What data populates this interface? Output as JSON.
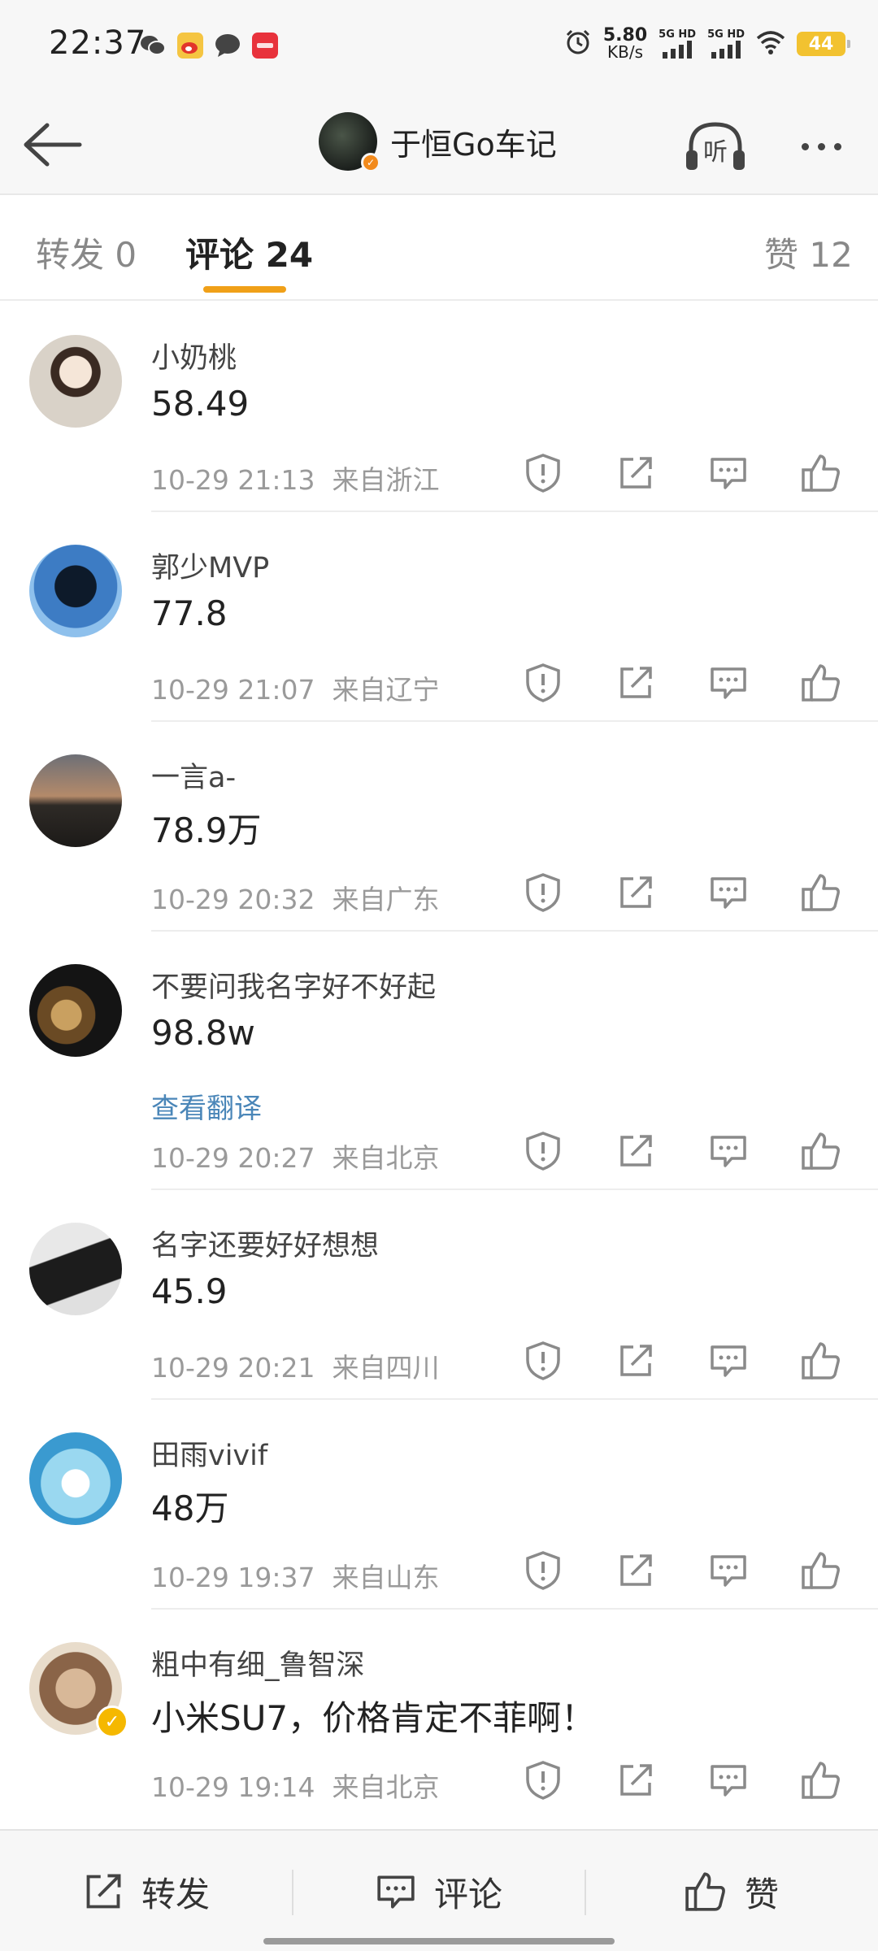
{
  "status_bar": {
    "time": "22:37",
    "left_icons": [
      "wechat-icon",
      "weibo-icon",
      "message-icon",
      "xiaohongshu-icon"
    ],
    "net_speed_value": "5.80",
    "net_speed_unit": "KB/s",
    "signal1_label": "5G HD",
    "signal2_label": "5G HD",
    "battery": "44",
    "battery_color": "#f2c230"
  },
  "header": {
    "title": "于恒Go车记",
    "verified_color": "#f28a1c",
    "listen_label": "听"
  },
  "tabs": [
    {
      "label": "转发 0",
      "active": false
    },
    {
      "label": "评论 24",
      "active": true
    },
    {
      "label": "赞 12",
      "active": false
    }
  ],
  "accent_color": "#f0a018",
  "comments": [
    {
      "name": "小奶桃",
      "text": "58.49",
      "time": "10-29 21:13",
      "location": "来自浙江"
    },
    {
      "name": "郭少MVP",
      "text": "77.8",
      "time": "10-29 21:07",
      "location": "来自辽宁"
    },
    {
      "name": "一言a-",
      "text": "78.9万",
      "time": "10-29 20:32",
      "location": "来自广东"
    },
    {
      "name": "不要问我名字好不好起",
      "text": "98.8w",
      "translate": "查看翻译",
      "time": "10-29 20:27",
      "location": "来自北京"
    },
    {
      "name": "名字还要好好想想",
      "text": "45.9",
      "time": "10-29 20:21",
      "location": "来自四川"
    },
    {
      "name": "田雨vivif",
      "text": "48万",
      "time": "10-29 19:37",
      "location": "来自山东"
    },
    {
      "name": "粗中有细_鲁智深",
      "text": "小米SU7，价格肯定不菲啊！",
      "time": "10-29 19:14",
      "location": "来自北京",
      "verified": true
    }
  ],
  "bottom_bar": {
    "repost": "转发",
    "comment": "评论",
    "like": "赞"
  }
}
